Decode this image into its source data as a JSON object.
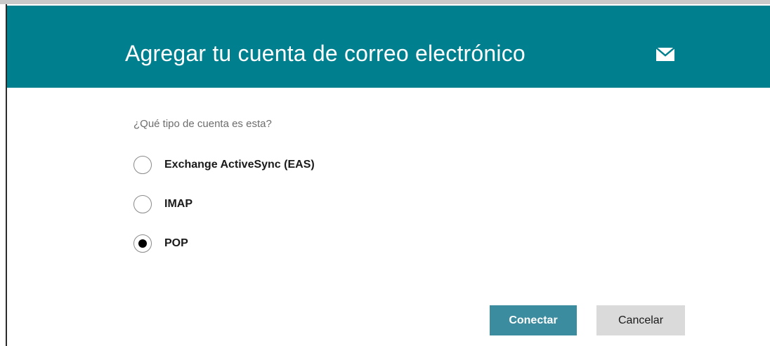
{
  "dialog": {
    "title": "Agregar tu cuenta de correo electrónico",
    "header_color": "#00808f",
    "icon": "envelope-icon"
  },
  "question": "¿Qué tipo de cuenta es esta?",
  "options": [
    {
      "label": "Exchange ActiveSync (EAS)",
      "selected": false
    },
    {
      "label": "IMAP",
      "selected": false
    },
    {
      "label": "POP",
      "selected": true
    }
  ],
  "buttons": {
    "connect_label": "Conectar",
    "cancel_label": "Cancelar",
    "connect_color": "#3a8c9e",
    "cancel_color": "#dadada"
  }
}
